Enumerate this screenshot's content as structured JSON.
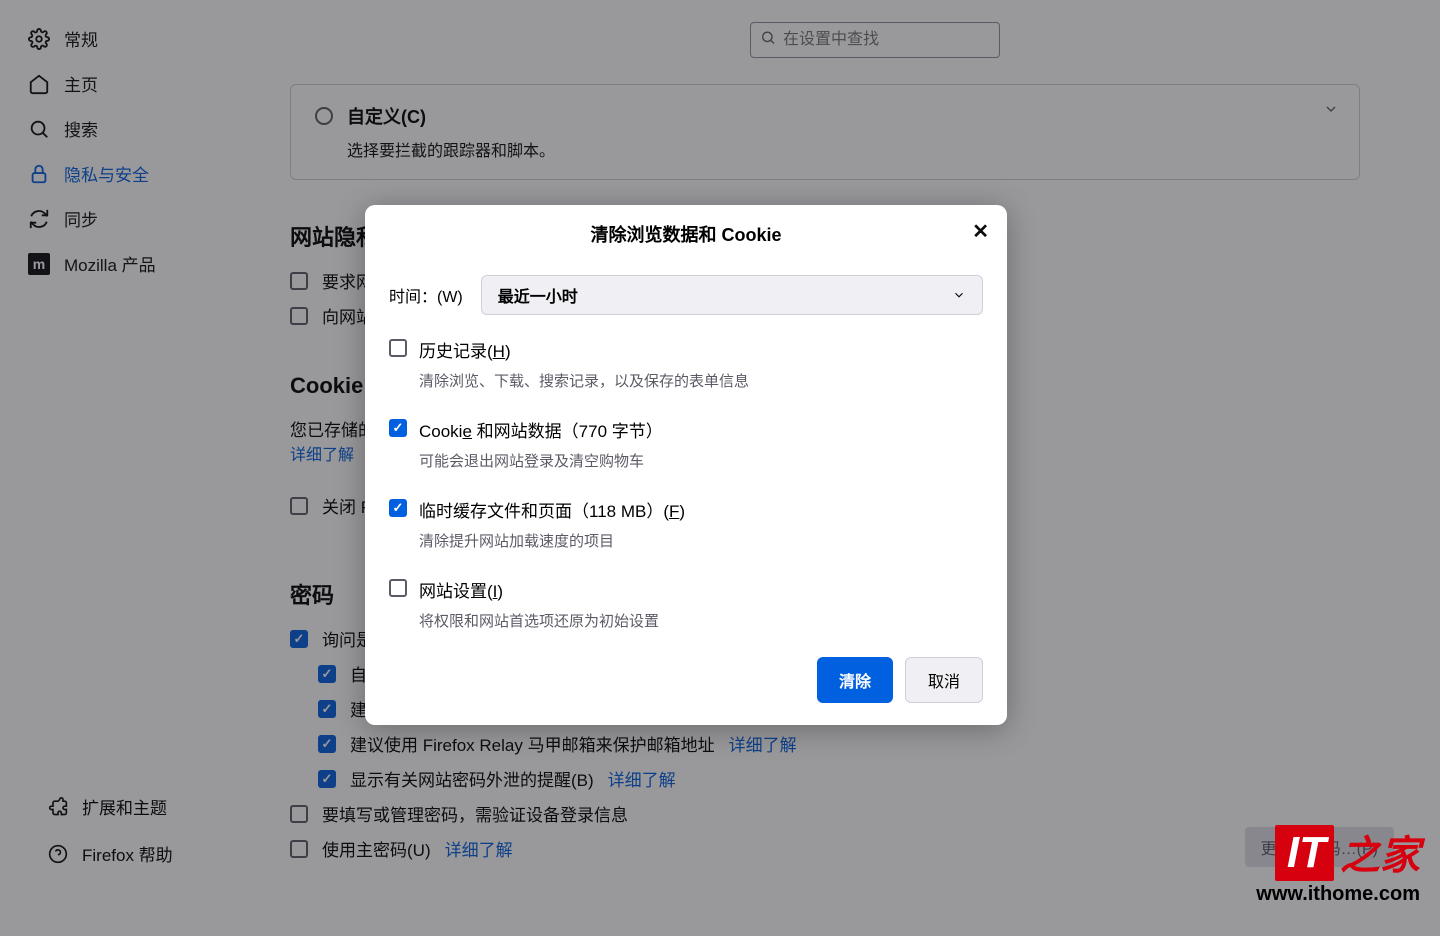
{
  "search": {
    "placeholder": "在设置中查找"
  },
  "sidebar": {
    "items": [
      {
        "label": "常规"
      },
      {
        "label": "主页"
      },
      {
        "label": "搜索"
      },
      {
        "label": "隐私与安全"
      },
      {
        "label": "同步"
      },
      {
        "label": "Mozilla 产品"
      }
    ],
    "footer": [
      {
        "label": "扩展和主题"
      },
      {
        "label": "Firefox 帮助"
      }
    ]
  },
  "custom_card": {
    "title": "自定义(C)",
    "sub": "选择要拦截的跟踪器和脚本。"
  },
  "section_privacy": {
    "title": "网站隐私",
    "r1": "要求网",
    "r2": "向网站"
  },
  "section_cookie": {
    "title": "Cookie 和",
    "desc": "您已存储的",
    "learn": "详细了解",
    "close_ff": "关闭 Fi"
  },
  "section_pwd": {
    "title": "密码",
    "ask": "询问是",
    "auto": "自动",
    "strong": "建议高强度密码…(S)",
    "relay": "建议使用 Firefox Relay 马甲邮箱来保护邮箱地址",
    "relay_link": "详细了解",
    "leak": "显示有关网站密码外泄的提醒(B)",
    "leak_link": "详细了解",
    "fill": "要填写或管理密码，需验证设备登录信息",
    "master": "使用主密码(U)",
    "master_link": "详细了解",
    "change_btn": "更改主密码…(P)"
  },
  "dialog": {
    "title": "清除浏览数据和 Cookie",
    "time_label": "时间：(W)",
    "time_value": "最近一小时",
    "options": [
      {
        "label_pre": "历史记录(",
        "label_key": "H",
        "label_post": ")",
        "sub": "清除浏览、下载、搜索记录，以及保存的表单信息",
        "checked": false
      },
      {
        "label_pre": "Cooki",
        "label_key": "e",
        "label_post": " 和网站数据（770 字节）",
        "sub": "可能会退出网站登录及清空购物车",
        "checked": true
      },
      {
        "label_pre": "临时缓存文件和页面（118 MB）(",
        "label_key": "F",
        "label_post": ")",
        "sub": "清除提升网站加载速度的项目",
        "checked": true
      },
      {
        "label_pre": "网站设置(",
        "label_key": "I",
        "label_post": ")",
        "sub": "将权限和网站首选项还原为初始设置",
        "checked": false
      }
    ],
    "clear": "清除",
    "cancel": "取消"
  },
  "watermark": {
    "zh": "之家",
    "url": "www.ithome.com"
  }
}
